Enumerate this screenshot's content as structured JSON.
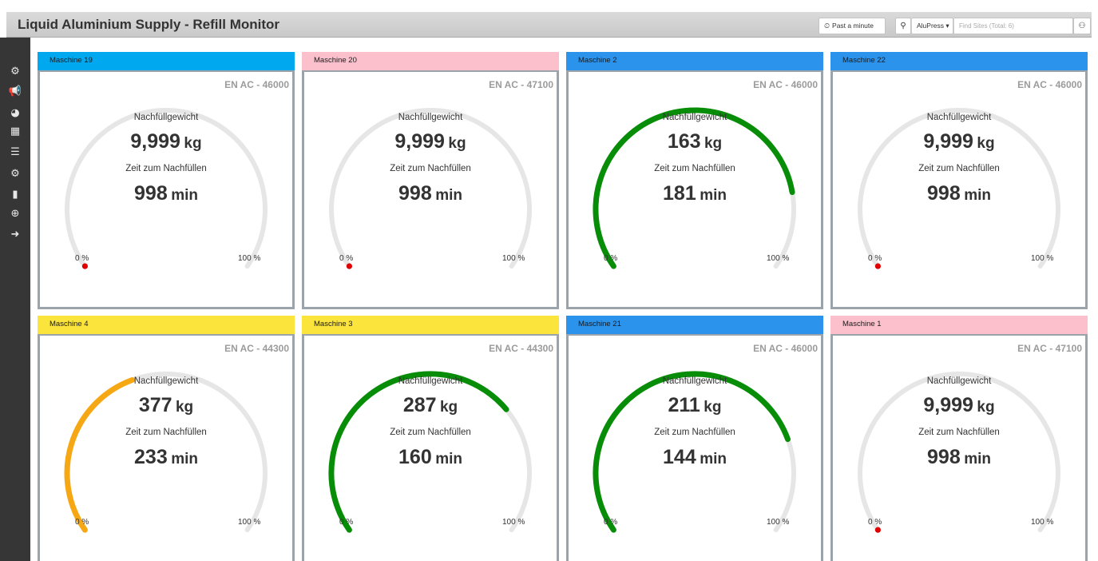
{
  "app": {
    "title": "Liquid Aluminium Supply - Refill Monitor"
  },
  "toolbar": {
    "time_icon": "⏲",
    "time_range": "Past a minute",
    "pin_icon": "⚲",
    "site": "AluPress ▾",
    "search_placeholder": "Find Sites (Total: 6)",
    "sitemap_icon": "⚇"
  },
  "sidebar": {
    "items": [
      {
        "name": "dashboard",
        "glyph": "⚙"
      },
      {
        "name": "megaphone",
        "glyph": "📢"
      },
      {
        "name": "dashboard-alt",
        "glyph": "◕"
      },
      {
        "name": "table",
        "glyph": "▦"
      },
      {
        "name": "list",
        "glyph": "☰"
      },
      {
        "name": "cogs",
        "glyph": "⚙"
      },
      {
        "name": "building",
        "glyph": "▮"
      },
      {
        "name": "globe",
        "glyph": "⊕"
      },
      {
        "name": "arrow-right-circle",
        "glyph": "➜"
      }
    ]
  },
  "labels": {
    "weight": "Nachfüllgewicht",
    "time": "Zeit zum Nachfüllen",
    "weight_unit": "kg",
    "time_unit": "min",
    "pct_min": "0 %",
    "pct_max": "100 %"
  },
  "colors": {
    "cyan": "#00a8f0",
    "blue": "#2b93ec",
    "pink": "#fbc0cb",
    "yellow": "#fbe43b",
    "green": "#088d08",
    "orange": "#f6a714",
    "red": "#e00000",
    "track": "#e6e6e6"
  },
  "machines": [
    {
      "name": "Maschine 19",
      "header_color": "#00a8f0",
      "alloy": "EN AC - 46000",
      "weight": "9,999",
      "time": "998",
      "fill": 0,
      "fill_color": "#088d08"
    },
    {
      "name": "Maschine 20",
      "header_color": "#fbc0cb",
      "alloy": "EN AC - 47100",
      "weight": "9,999",
      "time": "998",
      "fill": 0,
      "fill_color": "#088d08"
    },
    {
      "name": "Maschine 2",
      "header_color": "#2b93ec",
      "alloy": "EN AC - 46000",
      "weight": "163",
      "time": "181",
      "fill": 0.82,
      "fill_color": "#088d08"
    },
    {
      "name": "Maschine 22",
      "header_color": "#2b93ec",
      "alloy": "EN AC - 46000",
      "weight": "9,999",
      "time": "998",
      "fill": 0,
      "fill_color": "#088d08"
    },
    {
      "name": "Maschine 4",
      "header_color": "#fbe43b",
      "alloy": "EN AC - 44300",
      "weight": "377",
      "time": "233",
      "fill": 0.42,
      "fill_color": "#f6a714"
    },
    {
      "name": "Maschine 3",
      "header_color": "#fbe43b",
      "alloy": "EN AC - 44300",
      "weight": "287",
      "time": "160",
      "fill": 0.7,
      "fill_color": "#088d08"
    },
    {
      "name": "Maschine 21",
      "header_color": "#2b93ec",
      "alloy": "EN AC - 46000",
      "weight": "211",
      "time": "144",
      "fill": 0.78,
      "fill_color": "#088d08"
    },
    {
      "name": "Maschine 1",
      "header_color": "#fbc0cb",
      "alloy": "EN AC - 47100",
      "weight": "9,999",
      "time": "998",
      "fill": 0,
      "fill_color": "#088d08"
    }
  ]
}
